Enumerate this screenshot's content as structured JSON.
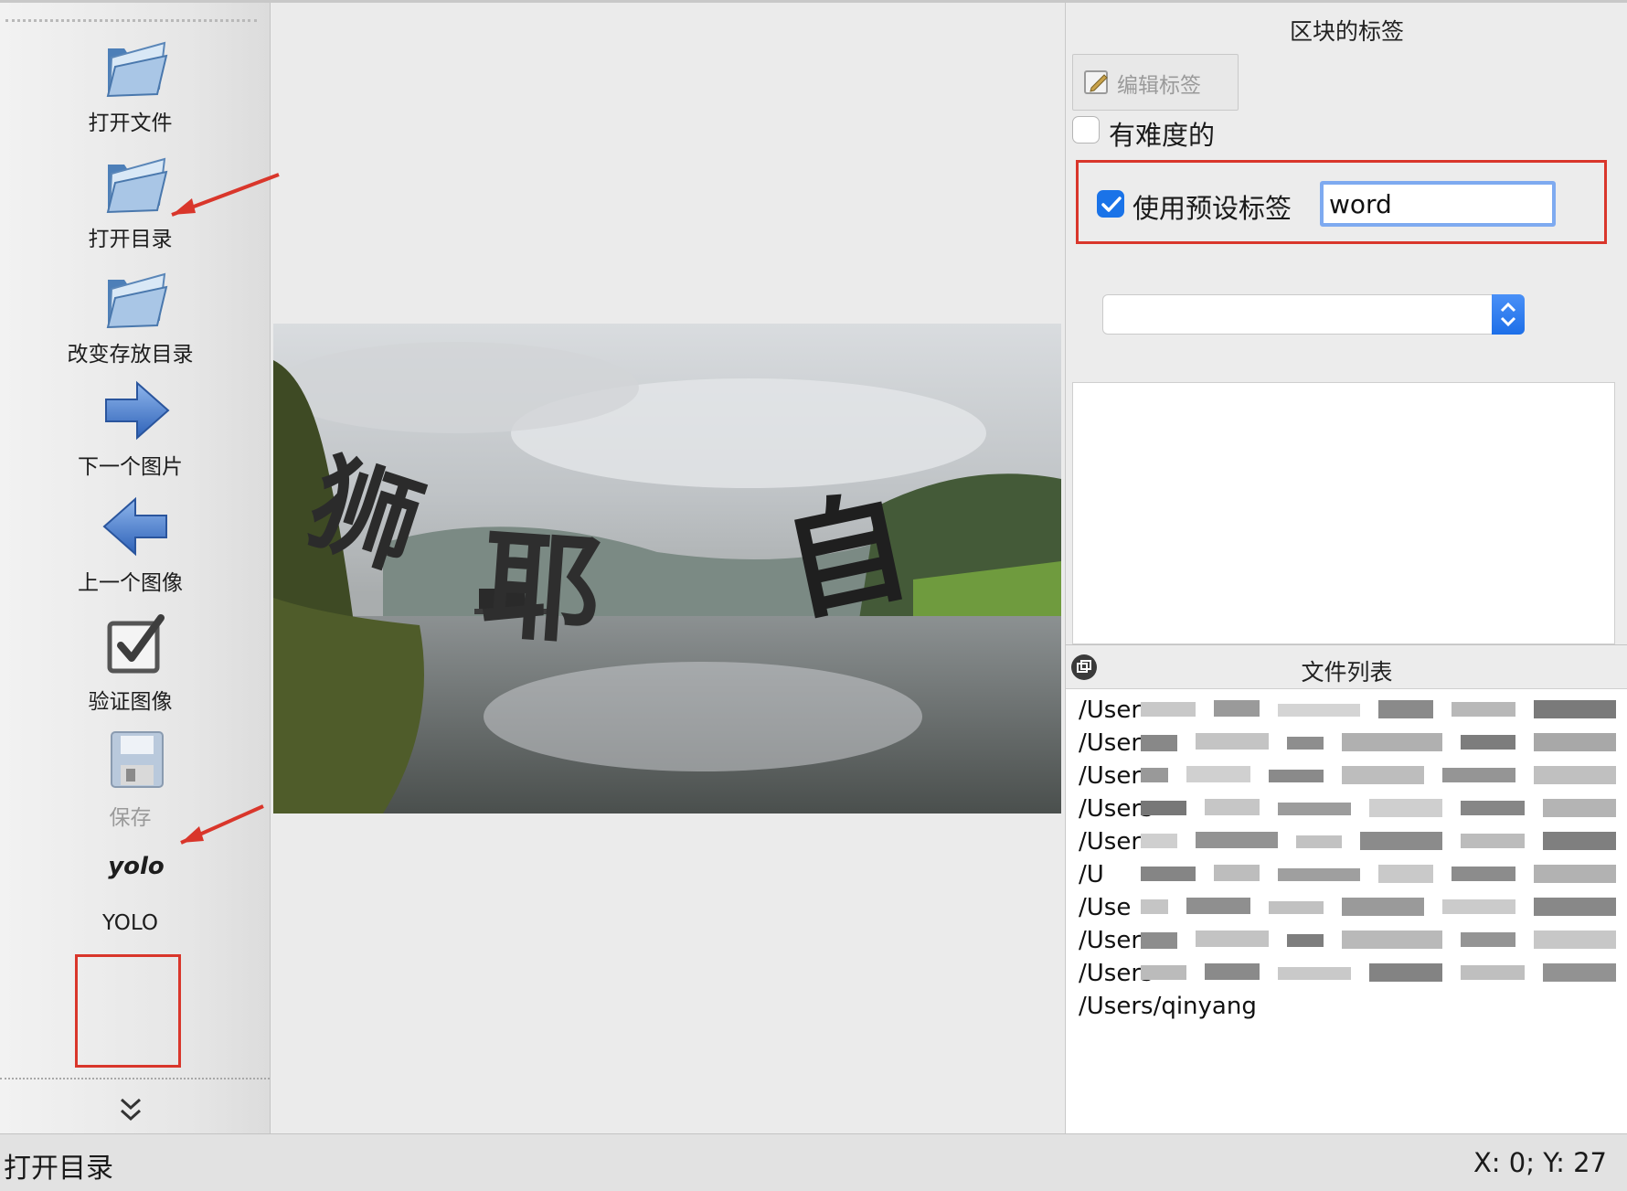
{
  "toolbar": {
    "items": [
      {
        "label": "打开文件",
        "icon": "folder-open-icon"
      },
      {
        "label": "打开目录",
        "icon": "folder-open-icon"
      },
      {
        "label": "改变存放目录",
        "icon": "folder-open-icon"
      },
      {
        "label": "下一个图片",
        "icon": "arrow-right-icon"
      },
      {
        "label": "上一个图像",
        "icon": "arrow-left-icon"
      },
      {
        "label": "验证图像",
        "icon": "checkbox-icon"
      },
      {
        "label": "保存",
        "icon": "floppy-disk-icon",
        "disabled": true
      },
      {
        "label": "YOLO",
        "icon_text": "yolo",
        "icon": "yolo-format-icon"
      }
    ],
    "more_icon": "double-chevron-down-icon"
  },
  "canvas": {
    "image_text": [
      "狮",
      "耶",
      "自"
    ]
  },
  "label_dock": {
    "title": "区块的标签",
    "edit_button": "编辑标签",
    "difficult": {
      "label": "有难度的",
      "checked": false
    },
    "use_default": {
      "label": "使用预设标签",
      "checked": true,
      "value": "word"
    },
    "combo_value": ""
  },
  "file_dock": {
    "title": "文件列表",
    "files": [
      "/User",
      "/Users",
      "/User",
      "/Users",
      "/User",
      "/U",
      "/Use",
      "/Users",
      "/Users",
      "/Users/qinyang"
    ]
  },
  "status": {
    "message": "打开目录",
    "coords": "X: 0; Y: 27"
  },
  "colors": {
    "accent": "#1a73e8",
    "annotation_red": "#d9362b"
  }
}
